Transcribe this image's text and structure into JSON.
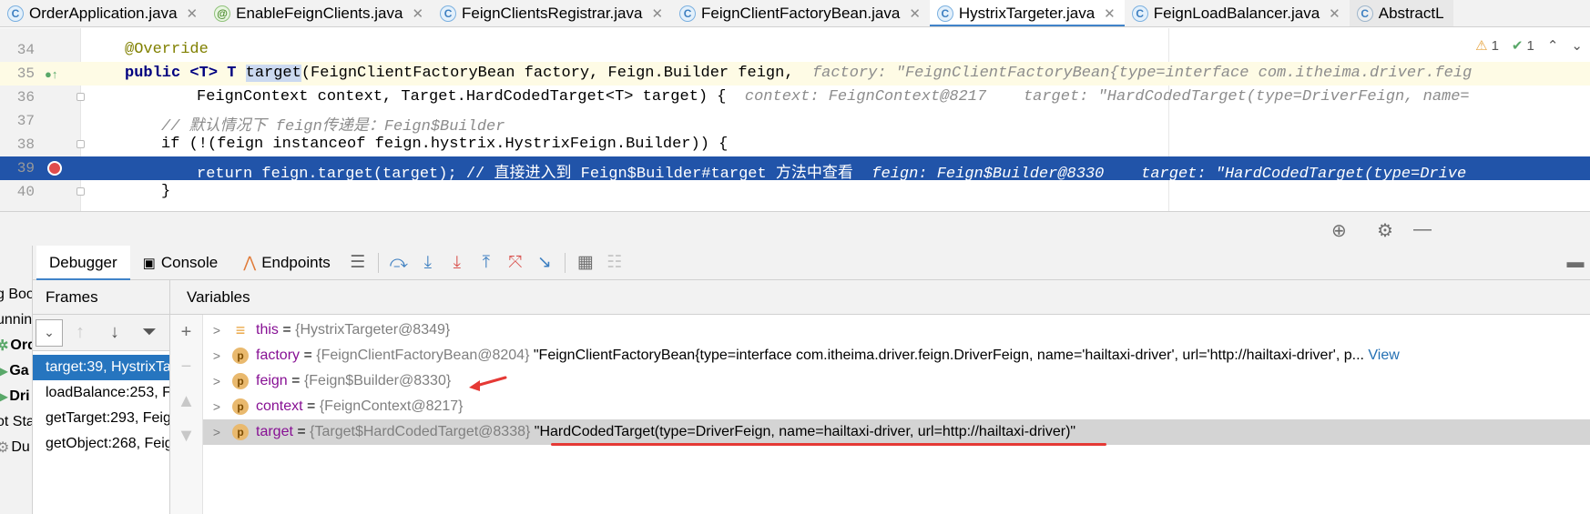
{
  "tabs": [
    {
      "label": "OrderApplication.java",
      "icon": "class-icon",
      "kind": "c"
    },
    {
      "label": "EnableFeignClients.java",
      "icon": "annotation-icon",
      "kind": "a"
    },
    {
      "label": "FeignClientsRegistrar.java",
      "icon": "class-icon",
      "kind": "c"
    },
    {
      "label": "FeignClientFactoryBean.java",
      "icon": "class-icon",
      "kind": "c"
    },
    {
      "label": "HystrixTargeter.java",
      "icon": "class-icon",
      "kind": "c",
      "active": true
    },
    {
      "label": "FeignLoadBalancer.java",
      "icon": "class-icon",
      "kind": "c"
    },
    {
      "label": "AbstractL",
      "icon": "abstract-class-icon",
      "kind": "ab"
    }
  ],
  "editor": {
    "lines": [
      {
        "num": "34",
        "text": "@Override"
      },
      {
        "num": "35",
        "text_pre": "public <T> T ",
        "text_sel": "target",
        "text_post": "(FeignClientFactoryBean factory, Feign.Builder feign,",
        "hint": "factory: \"FeignClientFactoryBean{type=interface com.itheima.driver.feig"
      },
      {
        "num": "36",
        "text": "FeignContext context, Target.HardCodedTarget<T> target) {",
        "hint": "context: FeignContext@8217    target: \"HardCodedTarget(type=DriverFeign, name="
      },
      {
        "num": "37",
        "text": "// 默认情况下 feign传递是：Feign$Builder"
      },
      {
        "num": "38",
        "text": "if (!(feign instanceof feign.hystrix.HystrixFeign.Builder)) {"
      },
      {
        "num": "39",
        "text": "return feign.target(target); // 直接进入到 Feign$Builder#target 方法中查看",
        "hint": "feign: Feign$Builder@8330    target: \"HardCodedTarget(type=Drive"
      },
      {
        "num": "40",
        "text": "}"
      }
    ],
    "inspections": {
      "warnings": "1",
      "ok": "1"
    }
  },
  "debug": {
    "tabs": [
      "Debugger",
      "Console",
      "Endpoints"
    ],
    "frames_title": "Frames",
    "variables_title": "Variables",
    "frames": [
      "target:39, HystrixTa",
      "loadBalance:253, Fe",
      "getTarget:293, Feig",
      "getObject:268, Feig"
    ],
    "strip": [
      "g Boo",
      "unnin",
      "Ord",
      "Ga",
      "Dri",
      "ot Sta",
      "Du"
    ],
    "variables": [
      {
        "name": "this",
        "type": "{HystrixTargeter@8349}",
        "value": "",
        "icon": "field"
      },
      {
        "name": "factory",
        "type": "{FeignClientFactoryBean@8204}",
        "value": "\"FeignClientFactoryBean{type=interface com.itheima.driver.feign.DriverFeign, name='hailtaxi-driver', url='http://hailtaxi-driver', p...",
        "link": "View",
        "icon": "p"
      },
      {
        "name": "feign",
        "type": "{Feign$Builder@8330}",
        "value": "",
        "icon": "p"
      },
      {
        "name": "context",
        "type": "{FeignContext@8217}",
        "value": "",
        "icon": "p"
      },
      {
        "name": "target",
        "type": "{Target$HardCodedTarget@8338}",
        "value": "\"HardCodedTarget(type=DriverFeign, name=hailtaxi-driver, url=http://hailtaxi-driver)\"",
        "icon": "p"
      }
    ]
  },
  "colors": {
    "accent": "#4083c9",
    "highlight": "#2154a9",
    "annotation_red": "#e53935"
  }
}
